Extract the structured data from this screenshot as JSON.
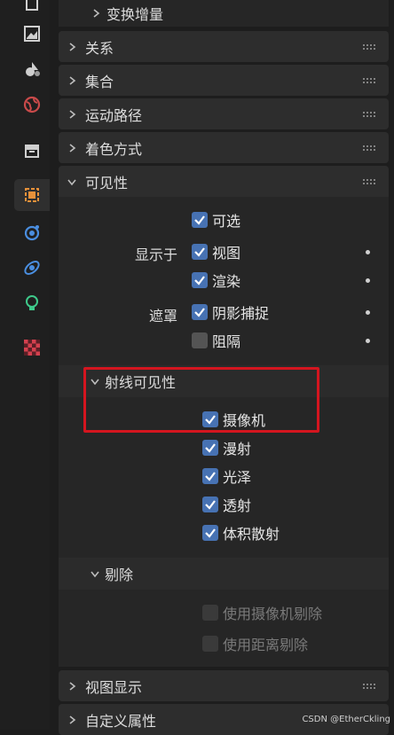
{
  "panels": {
    "transform_delta": "变换增量",
    "relations": "关系",
    "collections": "集合",
    "motion_paths": "运动路径",
    "shading": "着色方式",
    "visibility": "可见性",
    "viewport_display": "视图显示",
    "custom_properties": "自定义属性"
  },
  "visibility": {
    "selectable": "可选",
    "show_in_label": "显示于",
    "viewports": "视图",
    "renders": "渲染",
    "mask_label": "遮罩",
    "shadow_catcher": "阴影捕捉",
    "holdout": "阻隔"
  },
  "ray_visibility": {
    "title": "射线可见性",
    "camera": "摄像机",
    "diffuse": "漫射",
    "glossy": "光泽",
    "transmission": "透射",
    "volume_scatter": "体积散射"
  },
  "culling": {
    "title": "剔除",
    "camera_cull": "使用摄像机剔除",
    "distance_cull": "使用距离剔除"
  },
  "watermark": "CSDN @EtherCkling",
  "colors": {
    "accent": "#4772b3",
    "highlight": "#d4151f"
  }
}
